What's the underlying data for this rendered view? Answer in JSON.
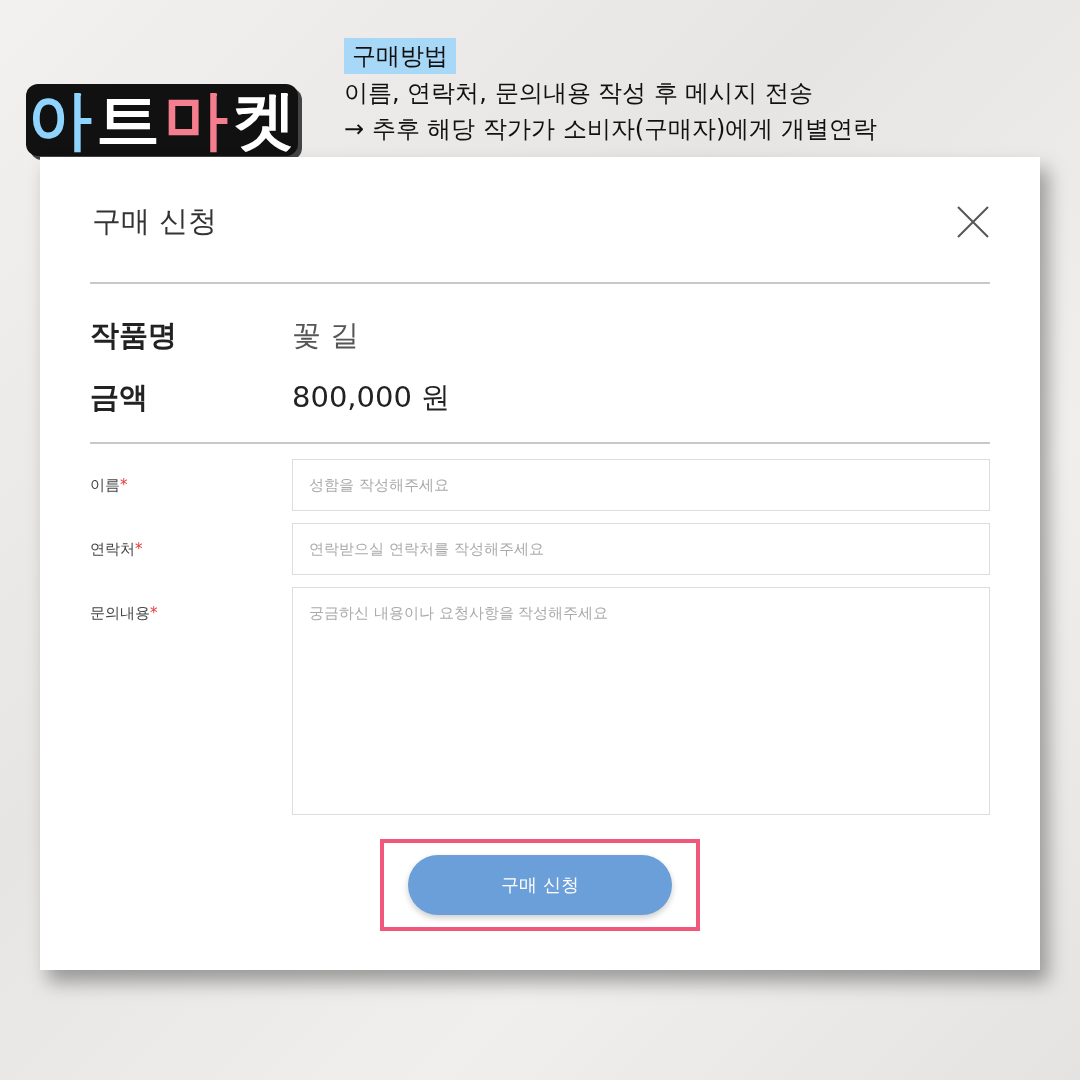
{
  "logo": {
    "letters": [
      "아",
      "트",
      "마",
      "켓"
    ]
  },
  "instructions": {
    "heading": "구매방법",
    "lines": [
      "이름, 연락처, 문의내용 작성 후 메시지 전송",
      "→ 추후 해당 작가가 소비자(구매자)에게 개별연락"
    ]
  },
  "dialog": {
    "title": "구매 신청",
    "info": [
      {
        "label": "작품명",
        "value": "꽃 길",
        "kind": "light"
      },
      {
        "label": "금액",
        "value": "800,000 원",
        "kind": "strong"
      }
    ],
    "fields": [
      {
        "label": "이름",
        "required_mark": "*",
        "placeholder": "성함을 작성해주세요",
        "kind": "input"
      },
      {
        "label": "연락처",
        "required_mark": "*",
        "placeholder": "연락받으실 연락처를 작성해주세요",
        "kind": "input"
      },
      {
        "label": "문의내용",
        "required_mark": "*",
        "placeholder": "궁금하신 내용이나 요청사항을 작성해주세요",
        "kind": "textarea"
      }
    ],
    "submit": {
      "label": "구매 신청",
      "highlighted": true
    }
  }
}
